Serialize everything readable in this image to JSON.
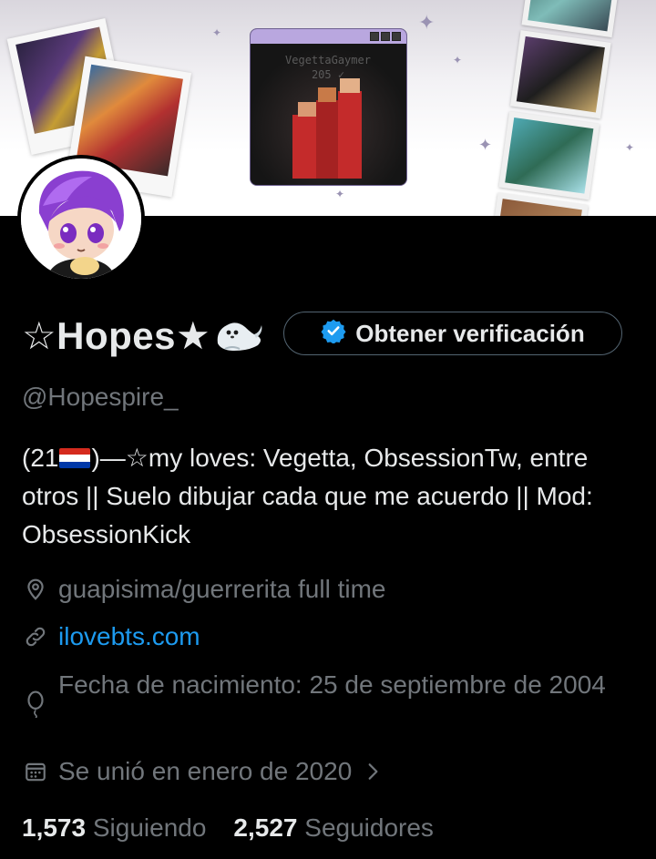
{
  "banner": {
    "window_caption_line1": "VegettaGaymer",
    "window_caption_line2": "205 ✓"
  },
  "profile": {
    "display_name": "☆Hopes★",
    "handle": "@Hopespire_",
    "verify_button_label": "Obtener verificación",
    "bio_prefix": "(21",
    "bio_after_flag": ")—☆my loves: Vegetta, ObsessionTw, entre otros || Suelo dibujar cada que me acuerdo || Mod: ObsessionKick",
    "location": "guapisima/guerrerita full time",
    "website": "ilovebts.com",
    "birthday": "Fecha de nacimiento: 25 de septiembre de 2004",
    "joined": "Se unió en enero de 2020"
  },
  "stats": {
    "following_count": "1,573",
    "following_label": "Siguiendo",
    "followers_count": "2,527",
    "followers_label": "Seguidores"
  },
  "icons": {
    "location": "map-pin-icon",
    "website": "link-icon",
    "birthday": "balloon-icon",
    "joined": "calendar-icon",
    "verify": "verified-badge-icon",
    "chevron": "chevron-right-icon",
    "name_emoji": "seal-icon",
    "flag": "paraguay-flag-icon"
  },
  "colors": {
    "background": "#000000",
    "text_primary": "#e7e9ea",
    "text_secondary": "#71767b",
    "link": "#1d9bf0",
    "verify_badge": "#1d9bf0"
  }
}
